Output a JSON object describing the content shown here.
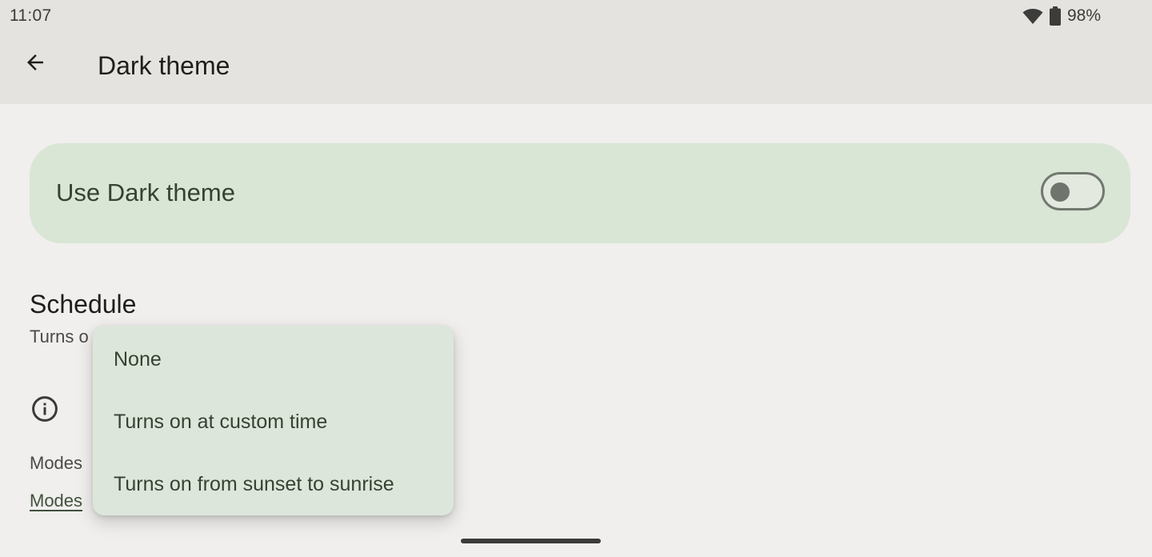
{
  "status_bar": {
    "time": "11:07",
    "battery_percent": "98%",
    "icons": [
      "wifi-icon",
      "battery-icon"
    ]
  },
  "app_bar": {
    "back_icon": "arrow-back-icon",
    "title": "Dark theme"
  },
  "main_toggle": {
    "label": "Use Dark theme",
    "checked": false
  },
  "schedule": {
    "title": "Schedule",
    "summary_visible": "Turns o"
  },
  "info": {
    "icon": "info-icon"
  },
  "footer": {
    "text_visible": "Modes",
    "link_visible": "Modes"
  },
  "dropdown": {
    "options": [
      {
        "label": "None"
      },
      {
        "label": "Turns on at custom time"
      },
      {
        "label": "Turns on from sunset to sunrise"
      }
    ]
  },
  "colors": {
    "background": "#f0efed",
    "app_bar": "#e4e3df",
    "card": "#d9e5d5",
    "dropdown": "#dde6da",
    "accent_text": "#354232"
  }
}
